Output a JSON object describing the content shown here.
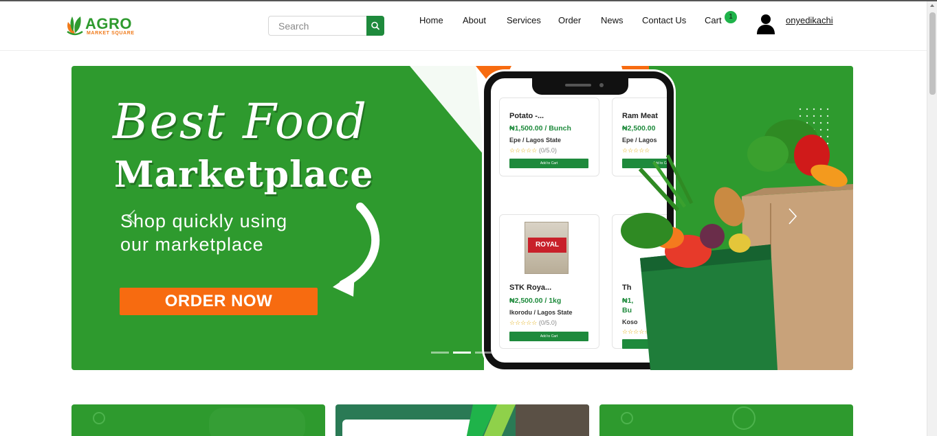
{
  "brand": {
    "name": "AGRO",
    "tagline": "MARKET SQUARE"
  },
  "search": {
    "placeholder": "Search"
  },
  "nav": {
    "items": [
      "Home",
      "About",
      "Services",
      "Order",
      "News",
      "Contact Us",
      "Cart"
    ],
    "cart_count": "1",
    "username": "onyedikachi"
  },
  "hero": {
    "title_line1": "Best Food",
    "title_line2": "Marketplace",
    "subtitle_line1": "Shop quickly using",
    "subtitle_line2": "our marketplace",
    "cta": "ORDER NOW",
    "slides_total": 3,
    "active_slide": 2
  },
  "phone_products": [
    {
      "name": "Potato -...",
      "price": "₦1,500.00 / Bunch",
      "location": "Epe / Lagos State",
      "rating": "(0/5.0)",
      "button": "Add to Cart"
    },
    {
      "name": "Ram Meat",
      "price": "₦2,500.00",
      "location": "Epe / Lagos",
      "rating": "",
      "button": "Add to Cart"
    },
    {
      "name": "STK Roya...",
      "price": "₦2,500.00 / 1kg",
      "location": "Ikorodu / Lagos State",
      "rating": "(0/5.0)",
      "button": "Add to Cart",
      "image_text": "ROYAL"
    },
    {
      "name": "Th",
      "price": "₦1,",
      "price_line2": "Bu",
      "location": "Koso",
      "rating": "",
      "button": "Add to Cart"
    }
  ],
  "stars": "☆☆☆☆☆",
  "colors": {
    "brand_green": "#2e9a2e",
    "button_green": "#1e8a3c",
    "accent_orange": "#f76b10",
    "badge_green": "#1fb34a"
  },
  "icons": {
    "search": "search-icon",
    "user": "user-icon",
    "prev": "chevron-left-icon",
    "next": "chevron-right-icon"
  }
}
